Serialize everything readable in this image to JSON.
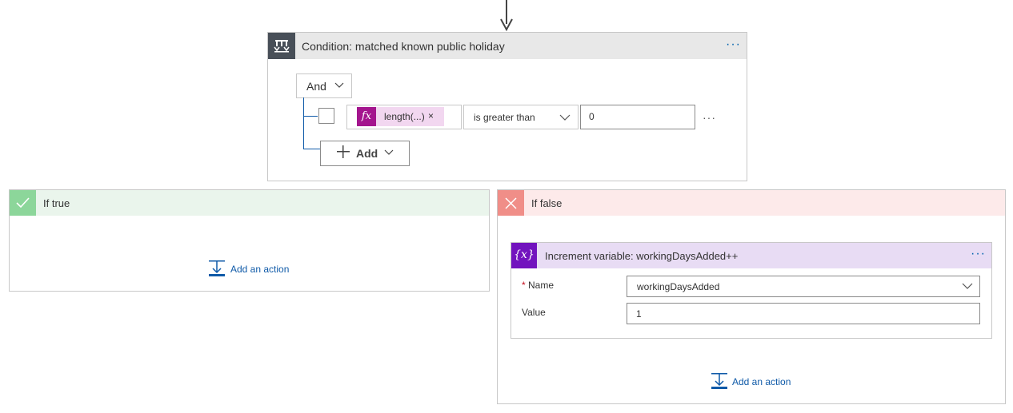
{
  "condition": {
    "title": "Condition: matched known public holiday",
    "more_label": "···",
    "group_operator": "And",
    "row": {
      "expression_token": "length(...)",
      "remove_label": "×",
      "operator": "is greater than",
      "value": "0",
      "more_label": "···"
    },
    "add_label": "Add"
  },
  "if_true": {
    "title": "If true",
    "add_action_label": "Add an action"
  },
  "if_false": {
    "title": "If false",
    "add_action_label": "Add an action",
    "increment": {
      "title": "Increment variable: workingDaysAdded++",
      "more_label": "···",
      "name_required_mark": "*",
      "name_label": "Name",
      "name_value": "workingDaysAdded",
      "value_label": "Value",
      "value_value": "1"
    }
  },
  "icons": {
    "condition": "condition-icon",
    "expression": "fx-icon",
    "true": "checkmark-icon",
    "false": "close-icon",
    "variable": "variable-icon",
    "add_action": "add-action-icon",
    "connector": "arrow-down-icon"
  },
  "colors": {
    "accent": "#0f5aa8",
    "condition_header": "#484f58",
    "expression_token": "#a4158e",
    "true_header": "#8cd69a",
    "false_header": "#f08e88",
    "variable_header": "#7213be"
  },
  "fx_symbol": "fx",
  "var_symbol": "{x}"
}
